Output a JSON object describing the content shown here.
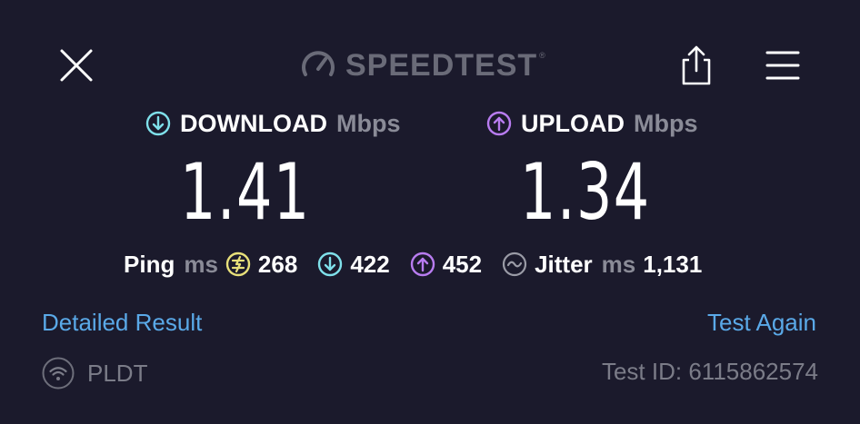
{
  "header": {
    "brand": "SPEEDTEST",
    "brand_tm": "®",
    "close_icon": "close-icon",
    "share_icon": "share-icon",
    "menu_icon": "menu-icon"
  },
  "download": {
    "label": "DOWNLOAD",
    "unit": "Mbps",
    "value": "1.41",
    "icon": "download-arrow-icon",
    "color": "#7fe0ea"
  },
  "upload": {
    "label": "UPLOAD",
    "unit": "Mbps",
    "value": "1.34",
    "icon": "upload-arrow-icon",
    "color": "#b87cf0"
  },
  "stats": {
    "ping_label": "Ping",
    "ping_unit": "ms",
    "idle_ping": "268",
    "idle_color": "#e8e07a",
    "download_ping": "422",
    "upload_ping": "452",
    "jitter_label": "Jitter",
    "jitter_unit": "ms",
    "jitter": "1,131"
  },
  "links": {
    "detailed": "Detailed Result",
    "again": "Test Again"
  },
  "footer": {
    "isp": "PLDT",
    "test_id": "Test ID: 6115862574"
  }
}
